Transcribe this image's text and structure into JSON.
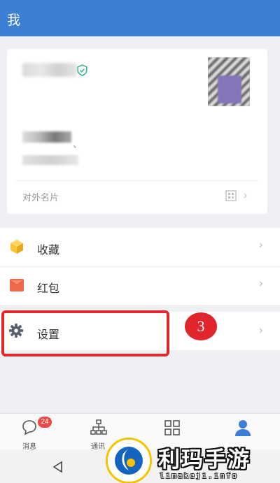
{
  "header": {
    "title": "我"
  },
  "profile": {
    "card_label": "对外名片",
    "chevron": "›"
  },
  "menu": {
    "items": [
      {
        "label": "收藏",
        "icon": "favorites-cube-icon",
        "color": "#f5b820"
      },
      {
        "label": "红包",
        "icon": "red-envelope-icon",
        "color": "#f06a4a"
      }
    ],
    "chevron": "›"
  },
  "settings": {
    "label": "设置",
    "icon": "gear-icon",
    "chevron": "›"
  },
  "annotation": {
    "step": "3",
    "color": "#e0282b"
  },
  "tabbar": {
    "items": [
      {
        "label": "消息",
        "icon": "chat-bubble-icon"
      },
      {
        "label": "通讯",
        "icon": "org-chart-icon"
      },
      {
        "label": "",
        "icon": "grid-apps-icon"
      },
      {
        "label": "",
        "icon": "person-icon"
      }
    ],
    "badge": "24",
    "accent": "#3c7fd4"
  },
  "watermark": {
    "title": "利玛手游",
    "url": "limakeji.info"
  }
}
